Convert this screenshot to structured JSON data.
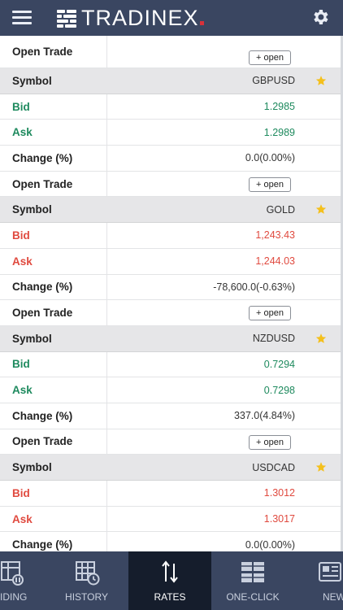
{
  "header": {
    "brand": "TRADINEX"
  },
  "colors": {
    "header_bg": "#3a4661",
    "up": "#1e8a5e",
    "down": "#e04a3f",
    "star": "#f4c01c",
    "brand_dot": "#d8313a"
  },
  "labels": {
    "symbol": "Symbol",
    "bid": "Bid",
    "ask": "Ask",
    "change": "Change (%)",
    "open_trade": "Open Trade",
    "open_button": "+ open"
  },
  "instruments": [
    {
      "symbol": "GBPUSD",
      "bid": "1.2985",
      "ask": "1.2989",
      "change": "0.0(0.00%)",
      "direction": "up",
      "favorite": true
    },
    {
      "symbol": "GOLD",
      "bid": "1,243.43",
      "ask": "1,244.03",
      "change": "-78,600.0(-0.63%)",
      "direction": "down",
      "favorite": true
    },
    {
      "symbol": "NZDUSD",
      "bid": "0.7294",
      "ask": "0.7298",
      "change": "337.0(4.84%)",
      "direction": "up",
      "favorite": true
    },
    {
      "symbol": "USDCAD",
      "bid": "1.3012",
      "ask": "1.3017",
      "change": "0.0(0.00%)",
      "direction": "down",
      "favorite": true
    }
  ],
  "tabs": [
    {
      "label": "IDING",
      "icon": "pending-orders-icon",
      "active": false
    },
    {
      "label": "HISTORY",
      "icon": "history-icon",
      "active": false
    },
    {
      "label": "RATES",
      "icon": "rates-icon",
      "active": true
    },
    {
      "label": "ONE-CLICK",
      "icon": "one-click-icon",
      "active": false
    },
    {
      "label": "NEW",
      "icon": "news-icon",
      "active": false
    }
  ]
}
